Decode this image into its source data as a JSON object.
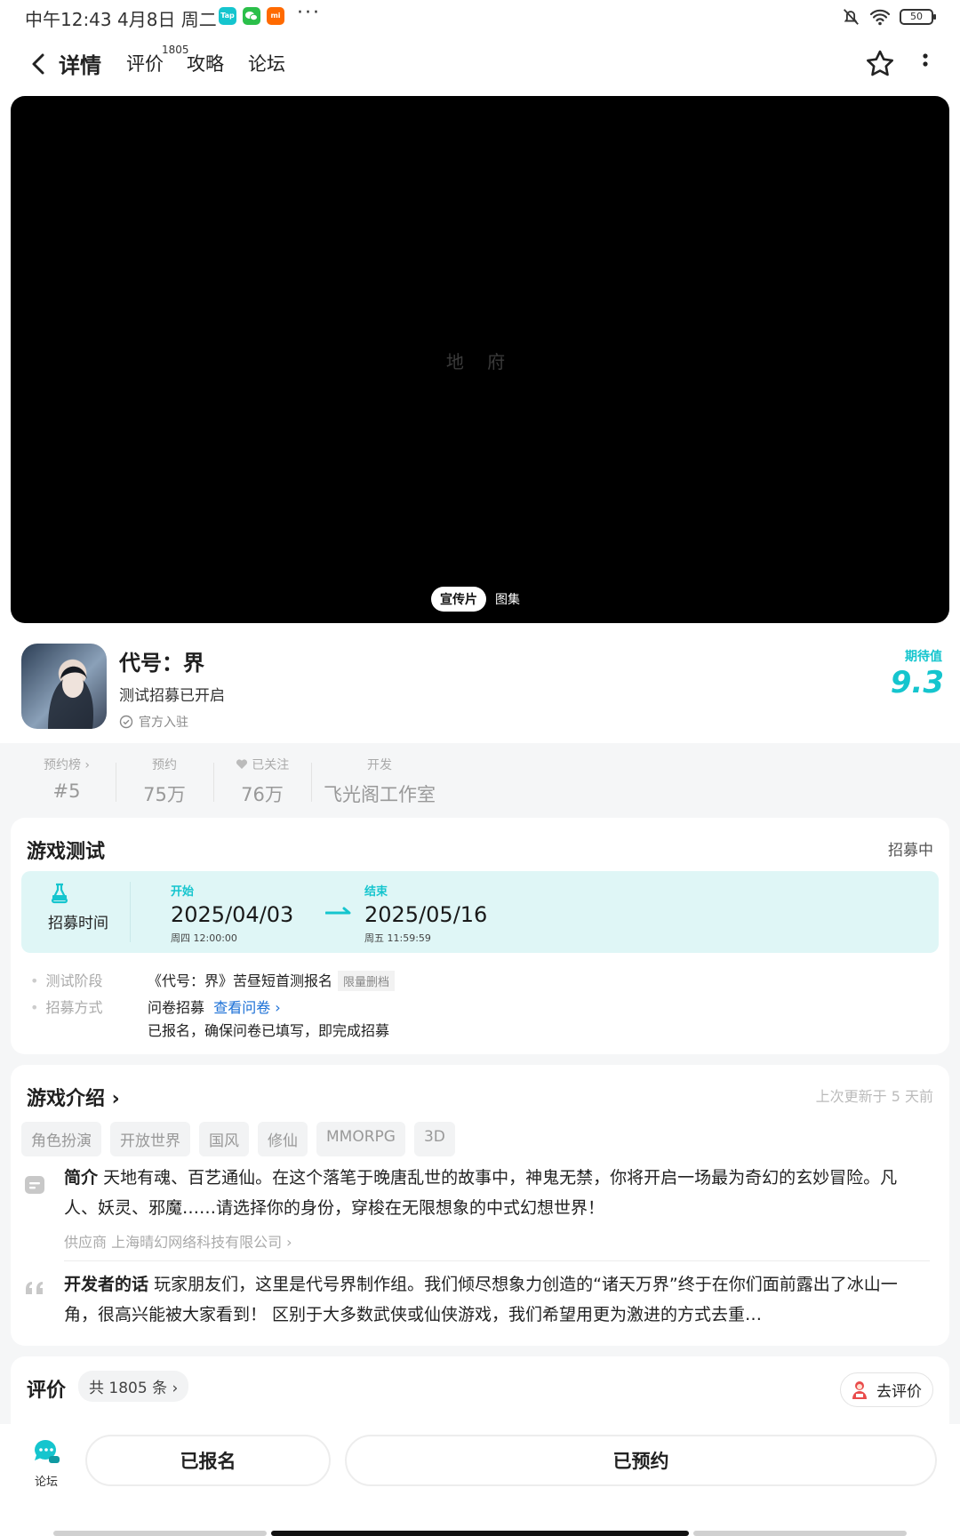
{
  "status_bar": {
    "time": "中午12:43 4月8日 周二",
    "apps": [
      {
        "name": "taptap-app-icon",
        "label": "Tap",
        "color": "#15c5ce"
      },
      {
        "name": "wechat-app-icon",
        "label": "",
        "color": "#2bbf4a"
      },
      {
        "name": "mi-app-icon",
        "label": "mi",
        "color": "#ff6a00"
      }
    ],
    "more": "···",
    "battery": "50"
  },
  "nav": {
    "tabs": [
      {
        "label": "详情",
        "active": true
      },
      {
        "label": "评价",
        "active": false
      },
      {
        "label": "攻略",
        "active": false
      },
      {
        "label": "论坛",
        "active": false
      }
    ],
    "review_sup": "1805"
  },
  "video": {
    "watermark": "地 府",
    "chips": {
      "active": "宣传片",
      "inactive": "图集"
    }
  },
  "game": {
    "title": "代号：界",
    "subtitle": "测试招募已开启",
    "official": "官方入驻",
    "score_label": "期待值",
    "score": "9.3"
  },
  "stats": [
    {
      "label": "预约榜 ›",
      "value": "#5"
    },
    {
      "label": "预约",
      "value": "75万"
    },
    {
      "label": "已关注",
      "value": "76万"
    },
    {
      "label": "开发",
      "value": "飞光阁工作室"
    }
  ],
  "test": {
    "title": "游戏测试",
    "status": "招募中",
    "recruit_label": "招募时间",
    "start": {
      "key": "开始",
      "date": "2025/04/03",
      "weekday_time": "周四  12:00:00"
    },
    "end": {
      "key": "结束",
      "date": "2025/05/16",
      "weekday_time": "周五  11:59:59"
    },
    "stage_label": "测试阶段",
    "stage_value": "《代号：界》苦昼短首测报名",
    "stage_tag": "限量删档",
    "method_label": "招募方式",
    "method_value": "问卷招募",
    "method_link": "查看问卷 ›",
    "method_note": "已报名，确保问卷已填写，即完成招募"
  },
  "intro": {
    "title": "游戏介绍 ›",
    "updated": "上次更新于 5 天前",
    "tags": [
      "角色扮演",
      "开放世界",
      "国风",
      "修仙",
      "MMORPG",
      "3D"
    ],
    "summary_label": "简介",
    "summary": "天地有魂、百艺通仙。在这个落笔于晚唐乱世的故事中，神鬼无禁，你将开启一场最为奇幻的玄妙冒险。凡人、妖灵、邪魔……请选择你的身份，穿梭在无限想象的中式幻想世界！",
    "supplier": "供应商 上海晴幻网络科技有限公司 ›",
    "dev_label": "开发者的话",
    "dev_words": "玩家朋友们，这里是代号界制作组。我们倾尽想象力创造的“诸天万界”终于在你们面前露出了冰山一角，很高兴能被大家看到！ 区别于大多数武侠或仙侠游戏，我们希望用更为激进的方式去重…"
  },
  "reviews": {
    "title": "评价",
    "count": "共 1805 条 ›",
    "go_review": "去评价"
  },
  "bottom": {
    "forum": "论坛",
    "signed_up": "已报名",
    "reserved": "已预约"
  },
  "colors": {
    "accent": "#15c5ce",
    "link": "#1a6fd6"
  }
}
